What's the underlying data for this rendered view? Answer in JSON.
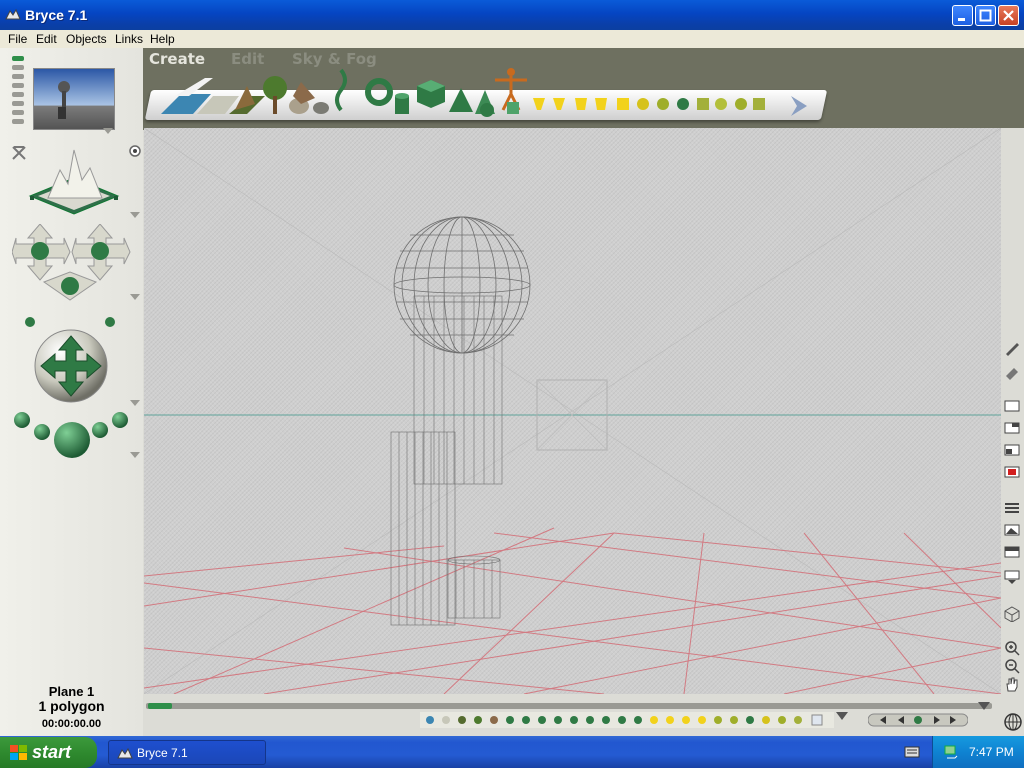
{
  "window": {
    "title": "Bryce 7.1"
  },
  "menu": [
    "File",
    "Edit",
    "Objects",
    "Links",
    "Help"
  ],
  "tabs": [
    "Create",
    "Edit",
    "Sky & Fog"
  ],
  "palette": {
    "items": [
      "water-plane-icon",
      "ground-plane-icon",
      "terrain-icon",
      "tree-icon",
      "rock-icon",
      "stone-icon",
      "symmetric-lattice-icon",
      "torus-icon",
      "cylinder-icon",
      "cube-icon",
      "pyramid-icon",
      "cone-icon",
      "figure-icon",
      "sphere-icon",
      "more-objects-icon"
    ]
  },
  "status": {
    "name": "Plane 1",
    "polygons": "1 polygon",
    "time": "00:00:00.00"
  },
  "taskbar": {
    "start_label": "start",
    "task_label": "Bryce 7.1",
    "clock": "7:47 PM"
  },
  "colors": {
    "accent_green": "#2f7a45",
    "grid_red": "#d27a82",
    "horizon": "#5fa39a",
    "wire": "#6f6f6f"
  }
}
